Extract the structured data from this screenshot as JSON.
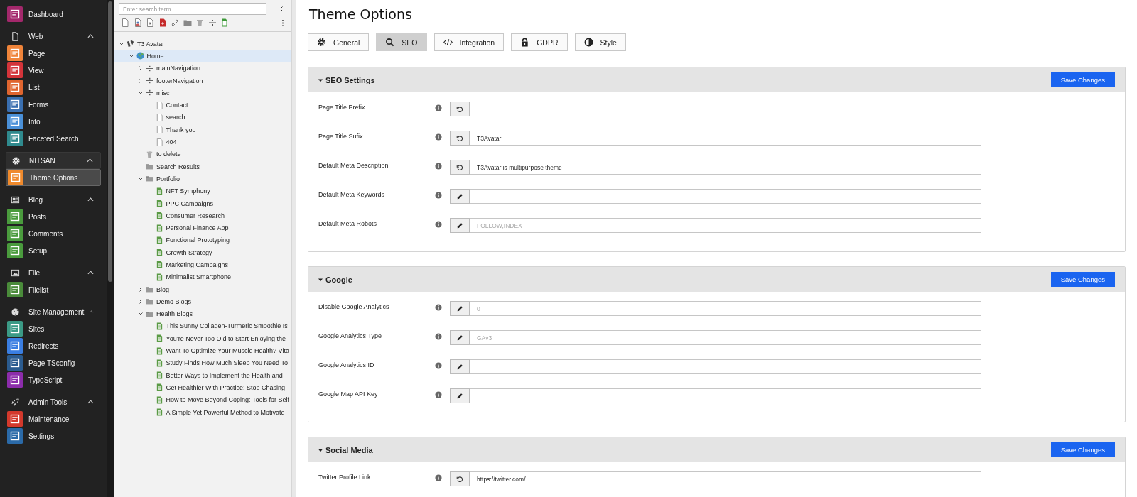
{
  "sidebar": {
    "items": [
      {
        "label": "Dashboard",
        "color": "#a3286b",
        "selected": false
      }
    ],
    "groups": [
      {
        "label": "Web",
        "kind": "page",
        "expanded": true,
        "active": false,
        "items": [
          {
            "label": "Page",
            "color": "#f0843a",
            "selected": false
          },
          {
            "label": "View",
            "color": "#d4343a",
            "selected": false
          },
          {
            "label": "List",
            "color": "#e0652f",
            "selected": false
          },
          {
            "label": "Forms",
            "color": "#3a6fb0",
            "selected": false
          },
          {
            "label": "Info",
            "color": "#4a90d8",
            "selected": false
          },
          {
            "label": "Faceted Search",
            "color": "#2f8a8e",
            "selected": false
          }
        ]
      },
      {
        "label": "NITSAN",
        "kind": "gear",
        "expanded": true,
        "active": true,
        "items": [
          {
            "label": "Theme Options",
            "color": "#f08a2c",
            "selected": true
          }
        ]
      },
      {
        "label": "Blog",
        "kind": "news",
        "expanded": true,
        "active": false,
        "items": [
          {
            "label": "Posts",
            "color": "#4a9b3d",
            "selected": false
          },
          {
            "label": "Comments",
            "color": "#4a9b3d",
            "selected": false
          },
          {
            "label": "Setup",
            "color": "#4a9b3d",
            "selected": false
          }
        ]
      },
      {
        "label": "File",
        "kind": "image",
        "expanded": true,
        "active": false,
        "items": [
          {
            "label": "Filelist",
            "color": "#4a8b3a",
            "selected": false
          }
        ]
      },
      {
        "label": "Site Management",
        "kind": "globe",
        "expanded": true,
        "active": false,
        "items": [
          {
            "label": "Sites",
            "color": "#3b9a86",
            "selected": false
          },
          {
            "label": "Redirects",
            "color": "#3a7ee2",
            "selected": false
          },
          {
            "label": "Page TSconfig",
            "color": "#2b5b8f",
            "selected": false
          },
          {
            "label": "TypoScript",
            "color": "#8c2cab",
            "selected": false
          }
        ]
      },
      {
        "label": "Admin Tools",
        "kind": "rocket",
        "expanded": true,
        "active": false,
        "items": [
          {
            "label": "Maintenance",
            "color": "#d3392c",
            "selected": false
          },
          {
            "label": "Settings",
            "color": "#2b6aa8",
            "selected": false
          }
        ]
      }
    ]
  },
  "tree": {
    "search": {
      "placeholder": "Enter search term"
    },
    "nodes": [
      {
        "label": "T3 Avatar",
        "kind": "root",
        "expanded": true,
        "selected": false,
        "children": [
          {
            "label": "Home",
            "kind": "globe",
            "expanded": true,
            "selected": true,
            "children": [
              {
                "label": "mainNavigation",
                "kind": "separator",
                "expanded": false,
                "selected": false
              },
              {
                "label": "footerNavigation",
                "kind": "separator",
                "expanded": false,
                "selected": false
              },
              {
                "label": "misc",
                "kind": "separator",
                "expanded": true,
                "selected": false,
                "children": [
                  {
                    "label": "Contact",
                    "kind": "page",
                    "selected": false
                  },
                  {
                    "label": "search",
                    "kind": "page",
                    "selected": false
                  },
                  {
                    "label": "Thank you",
                    "kind": "page",
                    "selected": false
                  },
                  {
                    "label": "404",
                    "kind": "page",
                    "selected": false
                  }
                ]
              },
              {
                "label": "to delete",
                "kind": "trash",
                "selected": false
              },
              {
                "label": "Search Results",
                "kind": "folder",
                "selected": false
              },
              {
                "label": "Portfolio",
                "kind": "folder",
                "expanded": true,
                "selected": false,
                "children": [
                  {
                    "label": "NFT Symphony",
                    "kind": "content",
                    "selected": false
                  },
                  {
                    "label": "PPC Campaigns",
                    "kind": "content",
                    "selected": false
                  },
                  {
                    "label": "Consumer Research",
                    "kind": "content",
                    "selected": false
                  },
                  {
                    "label": "Personal Finance App",
                    "kind": "content",
                    "selected": false
                  },
                  {
                    "label": "Functional Prototyping",
                    "kind": "content",
                    "selected": false
                  },
                  {
                    "label": "Growth Strategy",
                    "kind": "content",
                    "selected": false
                  },
                  {
                    "label": "Marketing Campaigns",
                    "kind": "content",
                    "selected": false
                  },
                  {
                    "label": "Minimalist Smartphone",
                    "kind": "content",
                    "selected": false
                  }
                ]
              },
              {
                "label": "Blog",
                "kind": "folder",
                "expanded": false,
                "selected": false
              },
              {
                "label": "Demo Blogs",
                "kind": "folder",
                "expanded": false,
                "selected": false
              },
              {
                "label": "Health Blogs",
                "kind": "folder",
                "expanded": true,
                "selected": false,
                "children": [
                  {
                    "label": "This Sunny Collagen-Turmeric Smoothie Is",
                    "kind": "content",
                    "selected": false
                  },
                  {
                    "label": "You’re Never Too Old to Start Enjoying the",
                    "kind": "content",
                    "selected": false
                  },
                  {
                    "label": "Want To Optimize Your Muscle Health? Vita",
                    "kind": "content",
                    "selected": false
                  },
                  {
                    "label": "Study Finds How Much Sleep You Need To",
                    "kind": "content",
                    "selected": false
                  },
                  {
                    "label": "Better Ways to Implement the Health and",
                    "kind": "content",
                    "selected": false
                  },
                  {
                    "label": "Get Healthier With Practice: Stop Chasing",
                    "kind": "content",
                    "selected": false
                  },
                  {
                    "label": "How to Move Beyond Coping: Tools for Self",
                    "kind": "content",
                    "selected": false
                  },
                  {
                    "label": "A Simple Yet Powerful Method to Motivate",
                    "kind": "content",
                    "selected": false
                  }
                ]
              }
            ]
          }
        ]
      }
    ]
  },
  "page": {
    "title": "Theme Options",
    "tabs": [
      {
        "label": "General",
        "kind": "gear",
        "selected": false
      },
      {
        "label": "SEO",
        "kind": "search",
        "selected": true
      },
      {
        "label": "Integration",
        "kind": "code",
        "selected": false
      },
      {
        "label": "GDPR",
        "kind": "lock",
        "selected": false
      },
      {
        "label": "Style",
        "kind": "contrast",
        "selected": false
      }
    ],
    "sections": [
      {
        "title": "SEO Settings",
        "expanded": true,
        "save_label": "Save Changes",
        "fields": [
          {
            "label": "Page Title Prefix",
            "kind": "reset"
          },
          {
            "label": "Page Title Sufix",
            "kind": "reset",
            "value": "T3Avatar"
          },
          {
            "label": "Default Meta Description",
            "kind": "reset",
            "value": "T3Avatar is multipurpose theme"
          },
          {
            "label": "Default Meta Keywords",
            "kind": "edit"
          },
          {
            "label": "Default Meta Robots",
            "kind": "edit",
            "placeholder": "FOLLOW,INDEX"
          }
        ]
      },
      {
        "title": "Google",
        "expanded": true,
        "save_label": "Save Changes",
        "fields": [
          {
            "label": "Disable Google Analytics",
            "kind": "edit",
            "placeholder": "0"
          },
          {
            "label": "Google Analytics Type",
            "kind": "edit",
            "placeholder": "GAv3"
          },
          {
            "label": "Google Analytics ID",
            "kind": "edit"
          },
          {
            "label": "Google Map API Key",
            "kind": "edit"
          }
        ]
      },
      {
        "title": "Social Media",
        "expanded": true,
        "save_label": "Save Changes",
        "fields": [
          {
            "label": "Twitter Profile Link",
            "kind": "reset",
            "value": "https://twitter.com/"
          }
        ]
      }
    ]
  }
}
